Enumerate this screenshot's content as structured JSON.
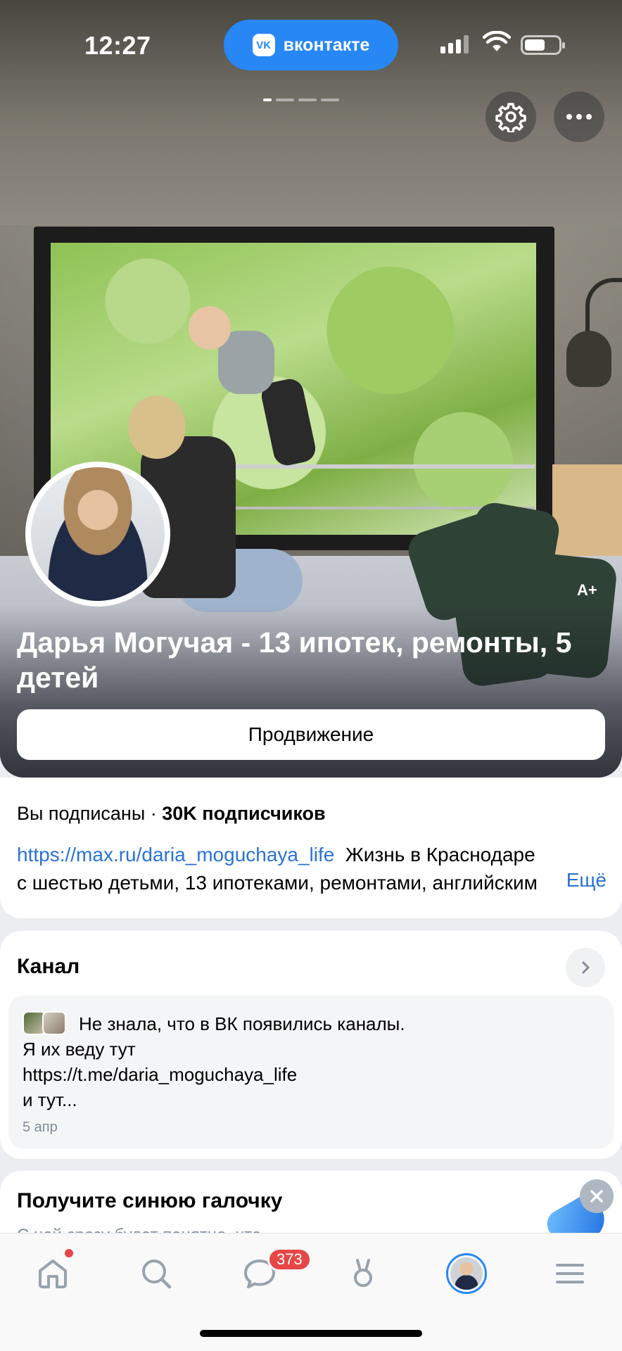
{
  "status_bar": {
    "time": "12:27",
    "app_pill": "вконтакте",
    "vk_logo": "VK"
  },
  "cover": {
    "badge": "A+"
  },
  "profile": {
    "name": "Дарья Могучая - 13 ипотек, ремонты, 5 детей",
    "promo_button": "Продвижение"
  },
  "info": {
    "subscribed": "Вы подписаны · ",
    "followers": "30K подписчиков",
    "link": "https://max.ru/daria_moguchaya_life",
    "desc_line1": "Жизнь в Краснодаре",
    "desc_line2": "с шестью детьми, 13 ипотеками, ремонтами, английским",
    "more": "Ещё"
  },
  "channel": {
    "title": "Канал",
    "post_lines": [
      "Не знала, что в ВК появились каналы.",
      "Я их веду тут",
      "https://t.me/daria_moguchaya_life",
      "и тут..."
    ],
    "date": "5 апр"
  },
  "promo_card": {
    "title": "Получите синюю галочку",
    "subtitle": "С ней сразу будет понятно, что"
  },
  "tabbar": {
    "messages_badge": "373"
  },
  "colors": {
    "accent": "#2787f5",
    "badge": "#e64646",
    "link": "#2a72d6",
    "muted": "#818c99"
  },
  "icons": [
    "gear-icon",
    "more-icon",
    "chevron-right-icon",
    "close-icon",
    "home-icon",
    "search-icon",
    "messages-icon",
    "clips-icon",
    "menu-icon",
    "wifi-icon",
    "battery-icon",
    "signal-icon"
  ]
}
